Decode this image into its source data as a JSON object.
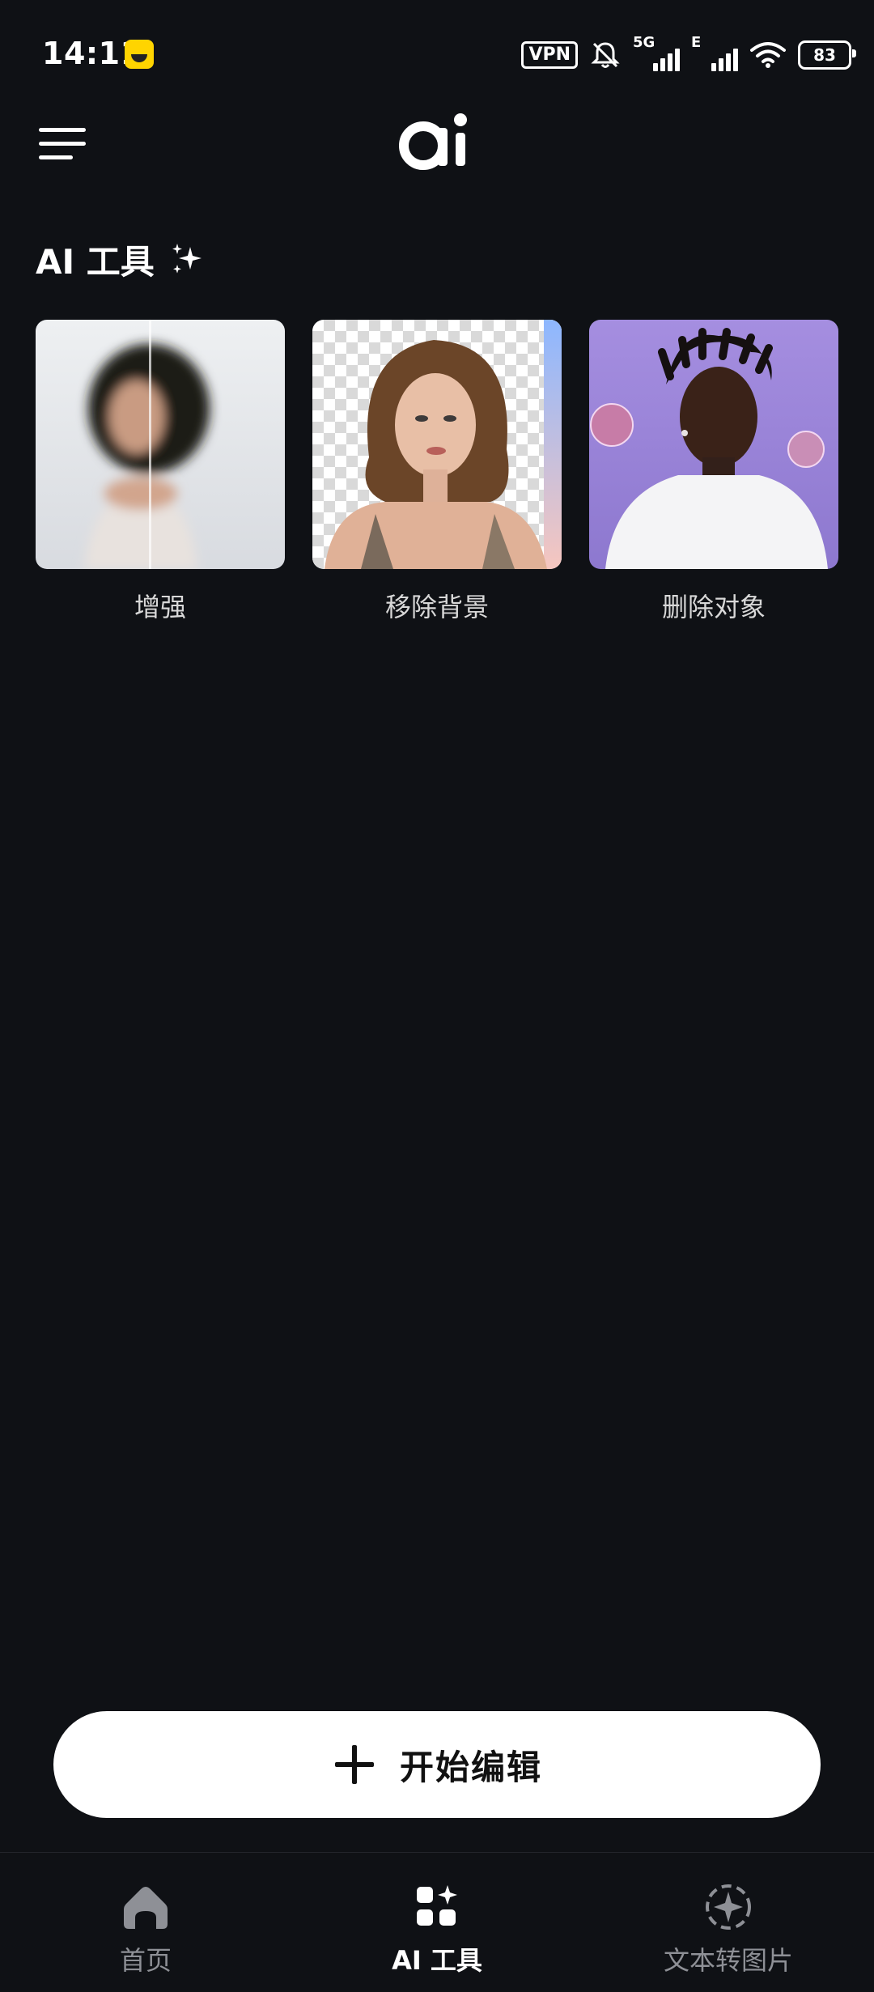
{
  "status_bar": {
    "time": "14:11",
    "vpn": "VPN",
    "signal_1_label": "5G",
    "signal_2_label": "E",
    "battery": "83"
  },
  "header": {
    "logo_text": "ai"
  },
  "section": {
    "title": "AI 工具"
  },
  "tools": [
    {
      "label": "增强"
    },
    {
      "label": "移除背景"
    },
    {
      "label": "删除对象"
    }
  ],
  "cta": {
    "label": "开始编辑"
  },
  "bottom_nav": [
    {
      "label": "首页",
      "icon": "home-icon",
      "active": false
    },
    {
      "label": "AI 工具",
      "icon": "ai-tools-icon",
      "active": true
    },
    {
      "label": "文本转图片",
      "icon": "text-to-image-icon",
      "active": false
    }
  ],
  "colors": {
    "background": "#0f1115",
    "inactive_nav": "#8e9096",
    "cta_bg": "#ffffff"
  }
}
